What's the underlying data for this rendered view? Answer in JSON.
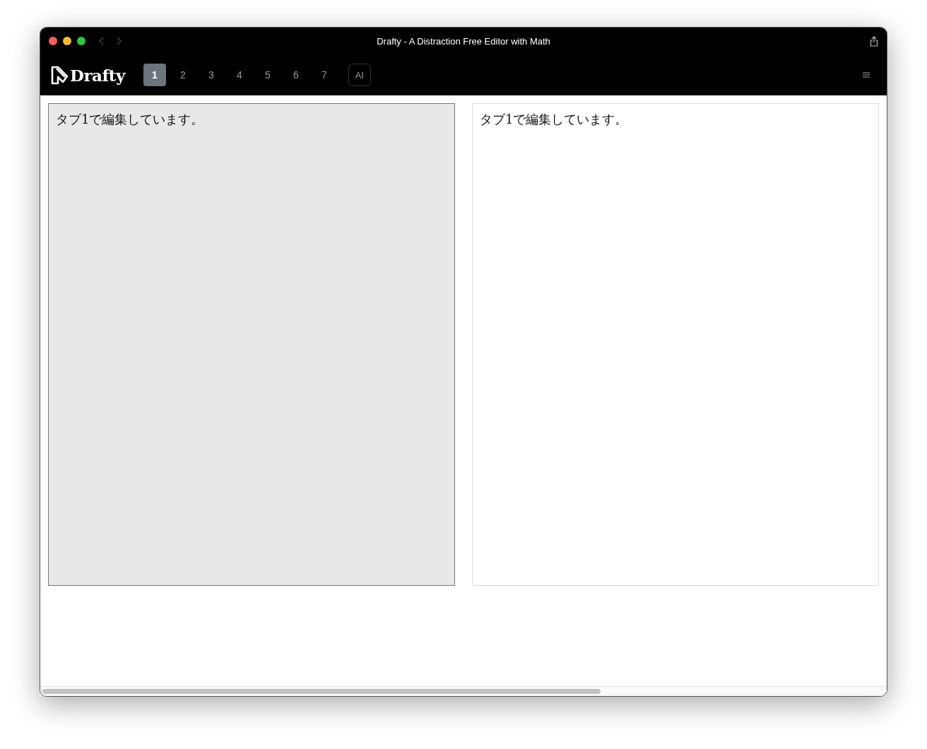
{
  "window": {
    "title": "Drafty - A Distraction Free Editor with Math"
  },
  "app": {
    "logo": "Drafty"
  },
  "tabs": [
    {
      "label": "1",
      "selected": true
    },
    {
      "label": "2",
      "selected": false
    },
    {
      "label": "3",
      "selected": false
    },
    {
      "label": "4",
      "selected": false
    },
    {
      "label": "5",
      "selected": false
    },
    {
      "label": "6",
      "selected": false
    },
    {
      "label": "7",
      "selected": false
    }
  ],
  "ai_button": "AI",
  "editor": {
    "value": "タブ1で編集しています。"
  },
  "preview": {
    "text": "タブ1で編集しています。"
  }
}
